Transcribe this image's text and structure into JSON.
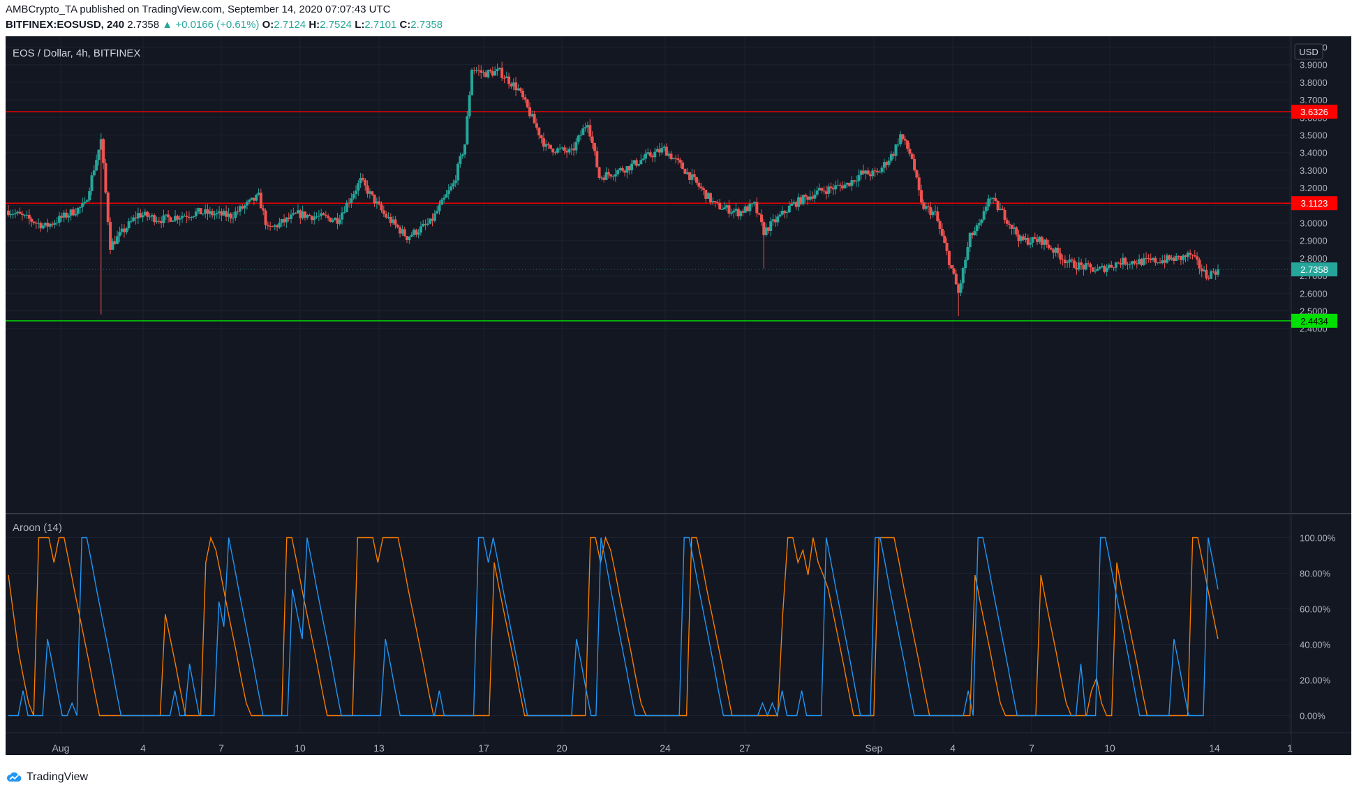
{
  "header": {
    "line1": "AMBCrypto_TA published on TradingView.com, September 14, 2020 07:07:43 UTC",
    "symbol": "BITFINEX:EOSUSD, 240",
    "last": "2.7358",
    "change": "+0.0166 (+0.61%)",
    "o_label": "O:",
    "o": "2.7124",
    "h_label": "H:",
    "h": "2.7524",
    "l_label": "L:",
    "l": "2.7101",
    "c_label": "C:",
    "c": "2.7358"
  },
  "pane_title": "EOS / Dollar, 4h, BITFINEX",
  "currency": "USD",
  "indicator_title": "Aroon (14)",
  "footer_brand": "TradingView",
  "colors": {
    "background": "#131722",
    "grid": "#1e2230",
    "up": "#26a69a",
    "down": "#ef5350",
    "aroon_up": "#f57c00",
    "aroon_down": "#2196f3",
    "resistance": "#ff0000",
    "support": "#00e000"
  },
  "chart_data": [
    {
      "type": "candlestick",
      "title": "EOS / Dollar, 4h, BITFINEX",
      "ylim": [
        2.33,
        4.1
      ],
      "y_ticks": [
        "4.0000",
        "3.9000",
        "3.8000",
        "3.7000",
        "3.6000",
        "3.5000",
        "3.4000",
        "3.3000",
        "3.2000",
        "3.1000",
        "3.0000",
        "2.9000",
        "2.8000",
        "2.7000",
        "2.6000",
        "2.5000",
        "2.4000"
      ],
      "x_ticks": [
        "Aug",
        "4",
        "7",
        "10",
        "13",
        "17",
        "20",
        "24",
        "27",
        "Sep",
        "4",
        "7",
        "10",
        "14",
        "1"
      ],
      "horizontal_lines": [
        {
          "value": 3.6326,
          "label": "3.6326",
          "color": "#ff0000"
        },
        {
          "value": 3.1123,
          "label": "3.1123",
          "color": "#ff0000"
        },
        {
          "value": 2.4434,
          "label": "2.4434",
          "color": "#00e000"
        }
      ],
      "last_price": {
        "value": 2.7358,
        "label": "2.7358"
      },
      "price_path": [
        [
          0,
          3.07
        ],
        [
          16,
          2.98
        ],
        [
          33,
          3.1
        ],
        [
          40,
          3.47
        ],
        [
          44,
          2.87
        ],
        [
          56,
          3.05
        ],
        [
          66,
          3.02
        ],
        [
          82,
          3.06
        ],
        [
          96,
          3.04
        ],
        [
          108,
          3.15
        ],
        [
          112,
          2.96
        ],
        [
          125,
          3.05
        ],
        [
          142,
          3.02
        ],
        [
          152,
          3.24
        ],
        [
          162,
          3.05
        ],
        [
          172,
          2.92
        ],
        [
          182,
          3.0
        ],
        [
          192,
          3.22
        ],
        [
          197,
          3.45
        ],
        [
          200,
          3.88
        ],
        [
          205,
          3.85
        ],
        [
          212,
          3.86
        ],
        [
          220,
          3.76
        ],
        [
          232,
          3.43
        ],
        [
          243,
          3.4
        ],
        [
          250,
          3.58
        ],
        [
          255,
          3.26
        ],
        [
          268,
          3.32
        ],
        [
          276,
          3.38
        ],
        [
          283,
          3.42
        ],
        [
          292,
          3.3
        ],
        [
          305,
          3.1
        ],
        [
          315,
          3.06
        ],
        [
          322,
          3.1
        ],
        [
          326,
          2.95
        ],
        [
          338,
          3.1
        ],
        [
          342,
          3.13
        ],
        [
          350,
          3.18
        ],
        [
          362,
          3.22
        ],
        [
          368,
          3.28
        ],
        [
          375,
          3.28
        ],
        [
          382,
          3.4
        ],
        [
          385,
          3.5
        ],
        [
          390,
          3.37
        ],
        [
          394,
          3.1
        ],
        [
          400,
          3.05
        ],
        [
          405,
          2.83
        ],
        [
          410,
          2.6
        ],
        [
          415,
          2.92
        ],
        [
          420,
          3.0
        ],
        [
          423,
          3.15
        ],
        [
          430,
          3.04
        ],
        [
          437,
          2.9
        ],
        [
          446,
          2.9
        ],
        [
          458,
          2.77
        ],
        [
          470,
          2.73
        ],
        [
          480,
          2.78
        ],
        [
          492,
          2.78
        ],
        [
          506,
          2.8
        ],
        [
          510,
          2.82
        ],
        [
          517,
          2.7
        ],
        [
          522,
          2.7358
        ]
      ]
    },
    {
      "type": "line",
      "title": "Aroon (14)",
      "ylim": [
        0,
        100
      ],
      "y_ticks": [
        "100.00%",
        "80.00%",
        "60.00%",
        "40.00%",
        "20.00%",
        "0.00%"
      ],
      "series": [
        {
          "name": "",
          "color": "#f57c00",
          "values": [
            79,
            57,
            36,
            21,
            7,
            0,
            100,
            100,
            100,
            86,
            100,
            100,
            86,
            71,
            57,
            43,
            29,
            14,
            0,
            0,
            0,
            0,
            0,
            0,
            0,
            0,
            0,
            0,
            0,
            0,
            0,
            57,
            43,
            29,
            14,
            0,
            0,
            0,
            0,
            86,
            100,
            93,
            79,
            64,
            50,
            36,
            21,
            7,
            0,
            0,
            0,
            0,
            0,
            0,
            0,
            100,
            100,
            86,
            71,
            57,
            43,
            29,
            14,
            0,
            0,
            0,
            0,
            0,
            0,
            100,
            100,
            100,
            100,
            86,
            100,
            100,
            100,
            100,
            86,
            71,
            57,
            43,
            29,
            14,
            0,
            0,
            0,
            0,
            0,
            0,
            0,
            0,
            0,
            0,
            0,
            0,
            86,
            71,
            57,
            43,
            29,
            14,
            0,
            0,
            0,
            0,
            0,
            0,
            0,
            0,
            0,
            0,
            0,
            0,
            0,
            100,
            100,
            86,
            100,
            93,
            79,
            64,
            50,
            36,
            21,
            7,
            0,
            0,
            0,
            0,
            0,
            0,
            0,
            0,
            0,
            100,
            100,
            86,
            71,
            57,
            43,
            29,
            14,
            0,
            0,
            0,
            0,
            0,
            0,
            0,
            0,
            0,
            0,
            57,
            100,
            100,
            86,
            93,
            79,
            100,
            86,
            79,
            71,
            57,
            43,
            29,
            14,
            0,
            0,
            0,
            0,
            0,
            100,
            100,
            100,
            100,
            86,
            71,
            57,
            43,
            29,
            14,
            0,
            0,
            0,
            0,
            0,
            0,
            0,
            0,
            0,
            79,
            64,
            50,
            36,
            21,
            7,
            0,
            0,
            0,
            0,
            0,
            0,
            0,
            79,
            64,
            50,
            36,
            21,
            7,
            0,
            0,
            0,
            0,
            14,
            21,
            7,
            0,
            0,
            86,
            71,
            57,
            43,
            29,
            14,
            0,
            0,
            0,
            0,
            0,
            0,
            0,
            0,
            0,
            100,
            100,
            86,
            71,
            57,
            43
          ]
        },
        {
          "name": "",
          "color": "#2196f3",
          "values": [
            0,
            0,
            0,
            14,
            0,
            0,
            0,
            0,
            43,
            29,
            14,
            0,
            0,
            7,
            0,
            100,
            100,
            86,
            71,
            57,
            43,
            29,
            14,
            0,
            0,
            0,
            0,
            0,
            0,
            0,
            0,
            0,
            0,
            0,
            14,
            0,
            0,
            29,
            14,
            0,
            0,
            0,
            0,
            64,
            50,
            100,
            86,
            71,
            57,
            43,
            29,
            14,
            0,
            0,
            0,
            0,
            0,
            0,
            71,
            57,
            43,
            100,
            86,
            71,
            57,
            43,
            29,
            14,
            0,
            0,
            0,
            0,
            0,
            0,
            0,
            0,
            0,
            43,
            29,
            14,
            0,
            0,
            0,
            0,
            0,
            0,
            0,
            0,
            14,
            0,
            0,
            0,
            0,
            0,
            0,
            0,
            100,
            100,
            86,
            100,
            86,
            71,
            57,
            43,
            29,
            14,
            0,
            0,
            0,
            0,
            0,
            0,
            0,
            0,
            0,
            0,
            43,
            29,
            14,
            0,
            0,
            100,
            86,
            71,
            57,
            43,
            29,
            14,
            0,
            0,
            0,
            0,
            0,
            0,
            0,
            0,
            0,
            0,
            100,
            100,
            86,
            71,
            57,
            43,
            29,
            14,
            0,
            0,
            0,
            0,
            0,
            0,
            0,
            0,
            7,
            0,
            7,
            0,
            14,
            0,
            0,
            0,
            14,
            0,
            0,
            0,
            0,
            100,
            86,
            71,
            57,
            43,
            29,
            14,
            0,
            0,
            0,
            100,
            100,
            86,
            71,
            57,
            43,
            29,
            14,
            0,
            0,
            0,
            0,
            0,
            0,
            0,
            0,
            0,
            0,
            0,
            14,
            0,
            100,
            100,
            86,
            71,
            57,
            43,
            29,
            14,
            0,
            0,
            0,
            0,
            0,
            0,
            0,
            0,
            0,
            0,
            0,
            0,
            0,
            29,
            0,
            0,
            0,
            100,
            100,
            86,
            71,
            57,
            43,
            29,
            14,
            0,
            0,
            0,
            0,
            0,
            0,
            0,
            43,
            29,
            14,
            0,
            0,
            0,
            0,
            100,
            86,
            71
          ]
        }
      ]
    }
  ]
}
